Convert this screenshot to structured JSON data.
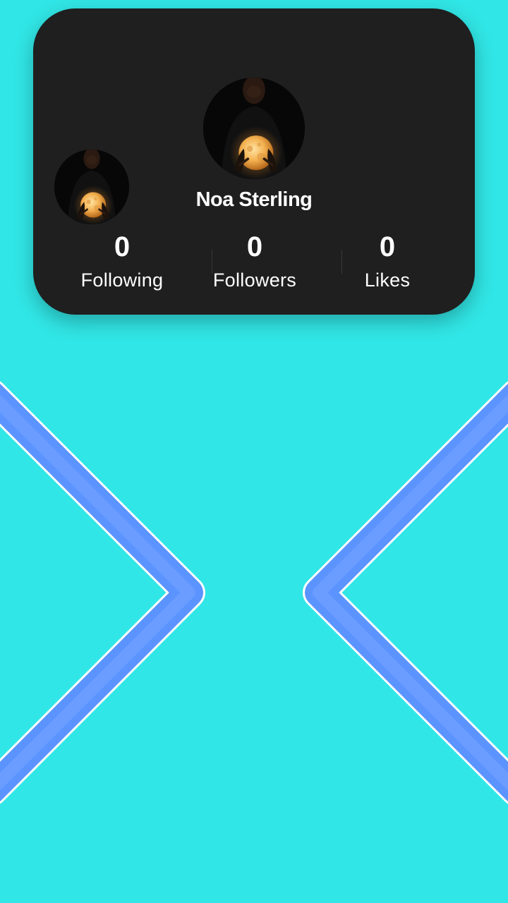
{
  "profile": {
    "name": "Noa Sterling",
    "avatar_icon": "avatar-moon-hands",
    "stats": [
      {
        "value": "0",
        "label": "Following"
      },
      {
        "value": "0",
        "label": "Followers"
      },
      {
        "value": "0",
        "label": "Likes"
      }
    ]
  },
  "navigation": {
    "previous_icon": "chevron-left-icon",
    "next_icon": "chevron-right-icon"
  },
  "colors": {
    "background": "#31e6e6",
    "card": "#1f1f1f",
    "chevron_fill": "#5b93ff",
    "chevron_outline": "#ffffff",
    "text": "#ffffff"
  }
}
